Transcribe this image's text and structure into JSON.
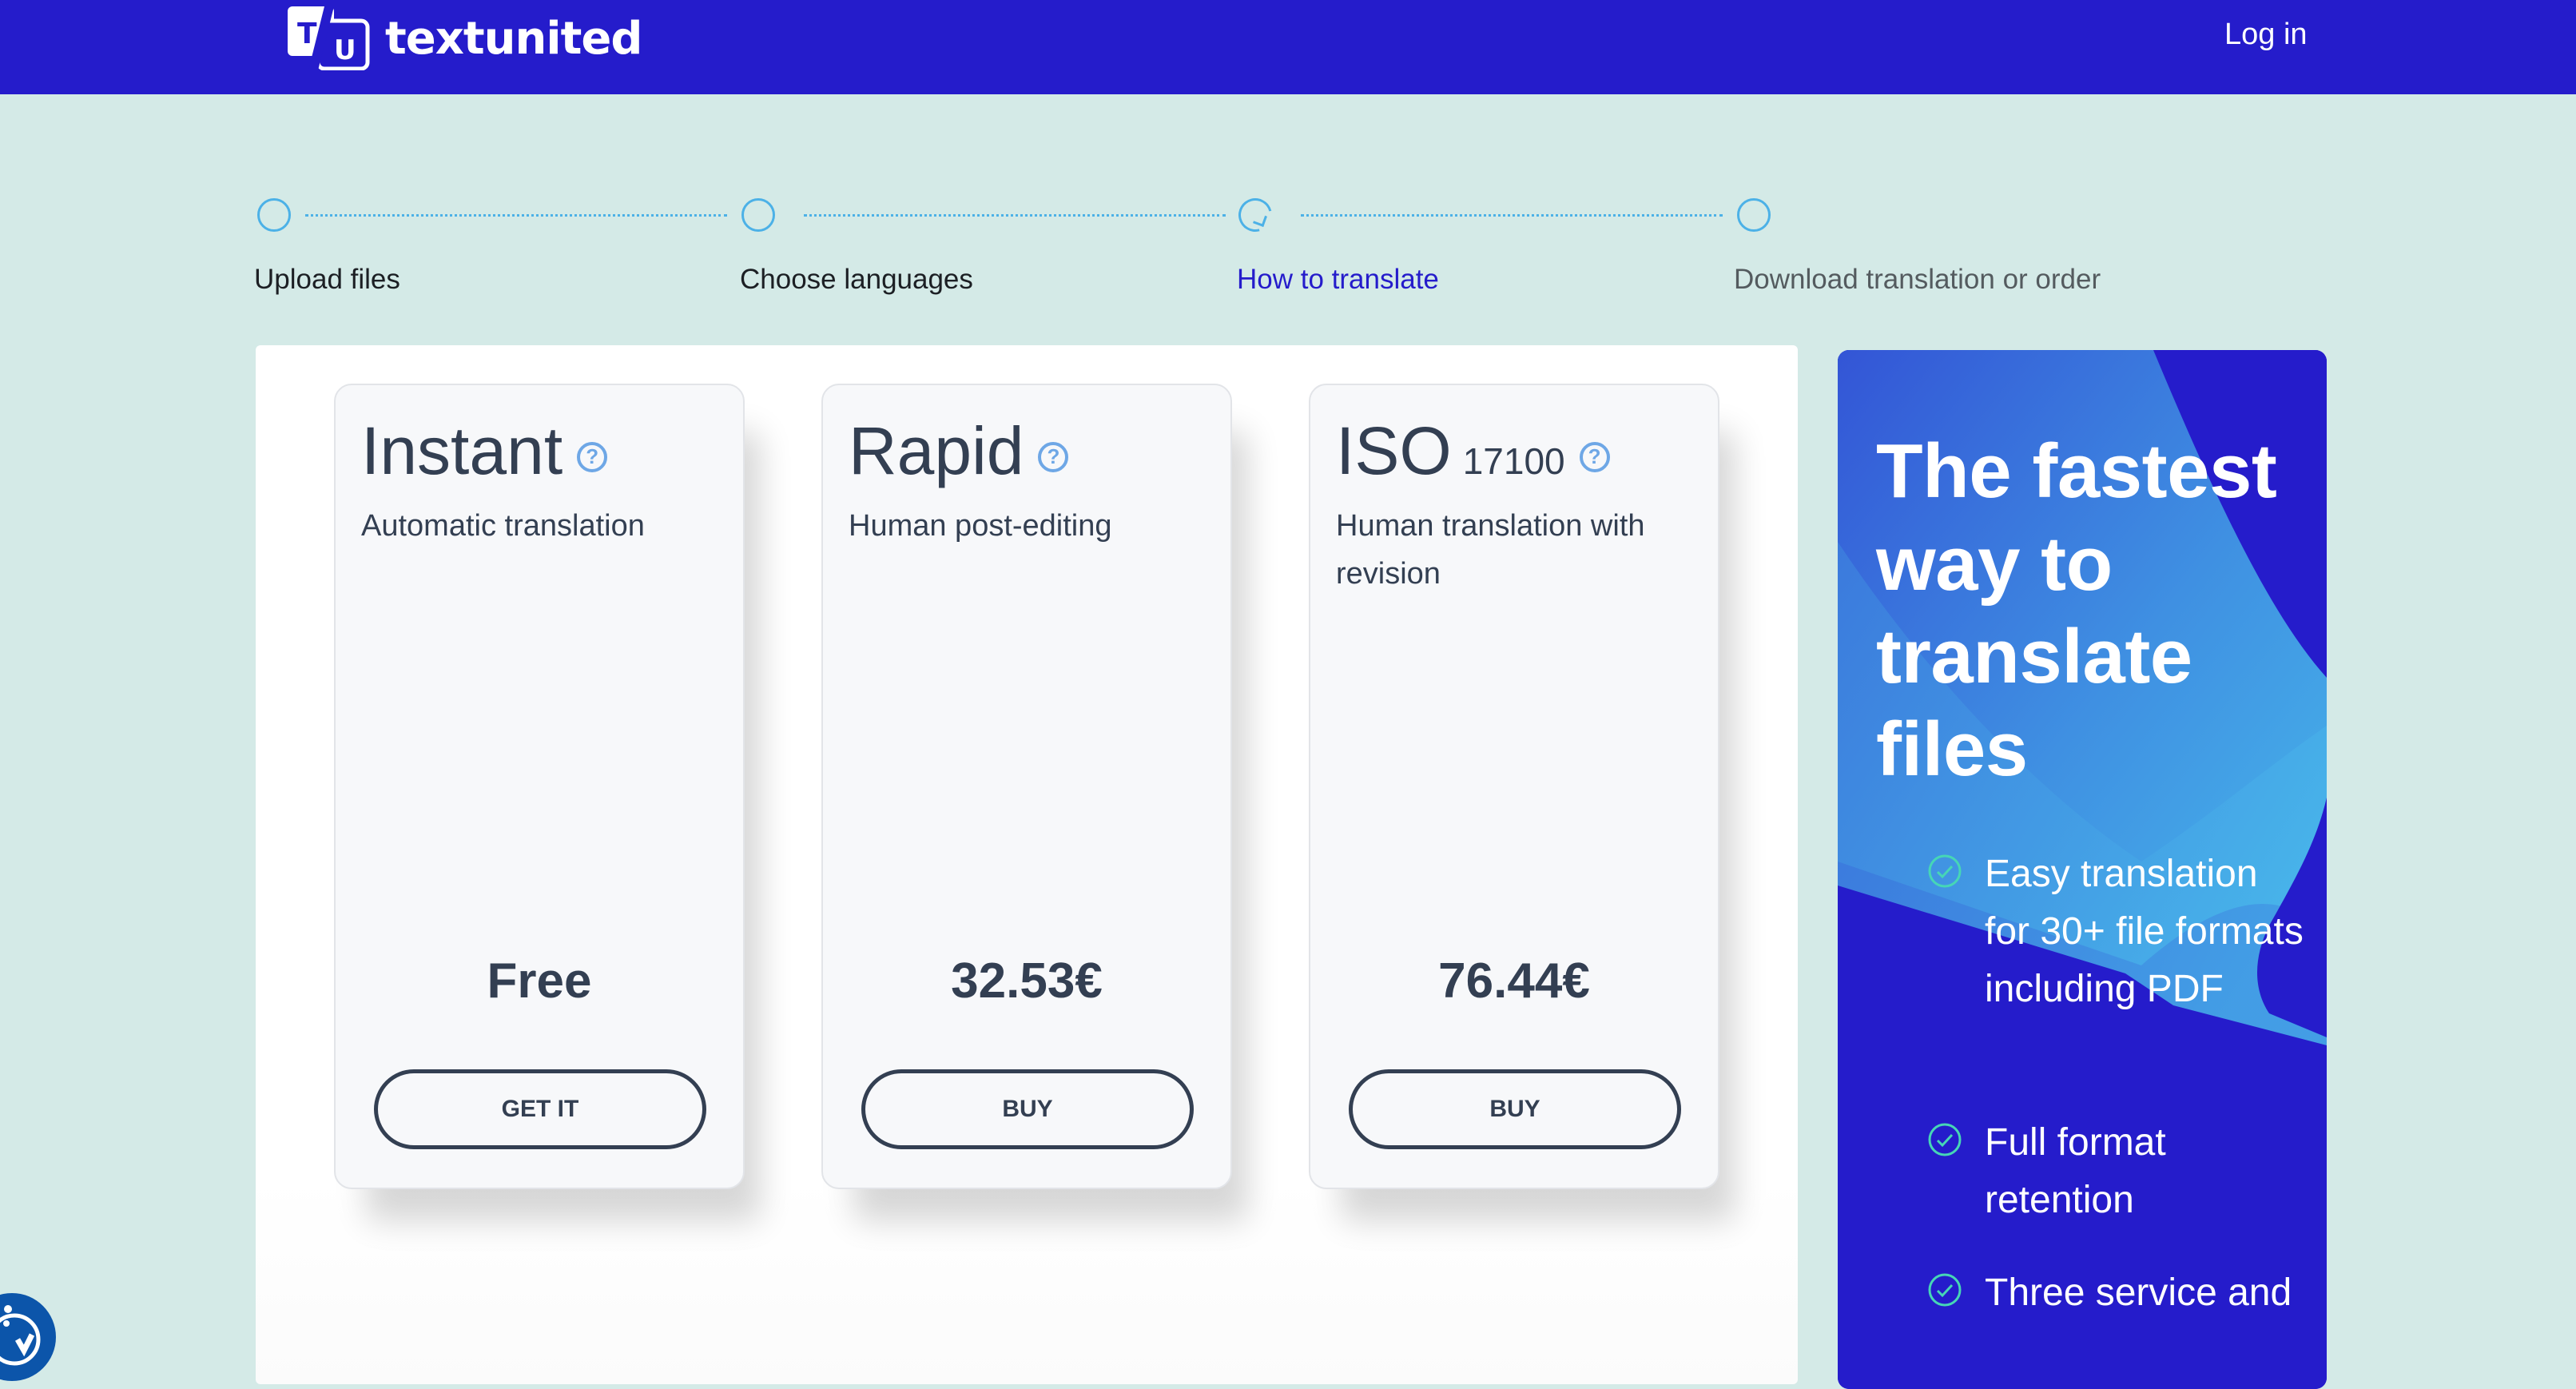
{
  "header": {
    "logo_mark_left": "T",
    "logo_mark_right": "U",
    "brand": "textunited",
    "login_label": "Log in",
    "brand_color": "#251ccb"
  },
  "stepper": {
    "steps": [
      {
        "label": "Upload files",
        "state": "done"
      },
      {
        "label": "Choose languages",
        "state": "done"
      },
      {
        "label": "How to translate",
        "state": "current"
      },
      {
        "label": "Download translation or order",
        "state": "future"
      }
    ],
    "accent_color": "#4cb1e7"
  },
  "options": [
    {
      "title": "Instant",
      "title_suffix": "",
      "description": "Automatic translation",
      "price": "Free",
      "button_label": "GET IT",
      "help_icon": "question-circle-icon"
    },
    {
      "title": "Rapid",
      "title_suffix": "",
      "description": "Human post-editing",
      "price": "32.53€",
      "button_label": "BUY",
      "help_icon": "question-circle-icon"
    },
    {
      "title": "ISO",
      "title_suffix": "17100",
      "description": "Human translation with revision",
      "price": "76.44€",
      "button_label": "BUY",
      "help_icon": "question-circle-icon"
    }
  ],
  "promo": {
    "title": "The fastest way to translate files",
    "features": [
      "Easy translation for 30+ file formats including PDF",
      "Full format retention",
      "Three service and"
    ],
    "check_icon": "check-circle-icon",
    "check_color": "#46d6b6"
  },
  "cookie_button": {
    "icon": "cookie-consent-icon"
  }
}
